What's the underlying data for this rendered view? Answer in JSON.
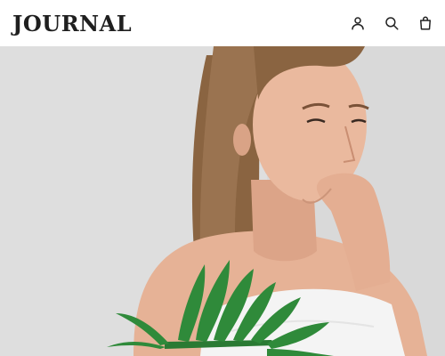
{
  "header": {
    "logo_text": "JOURNAL",
    "icons": [
      "account-icon",
      "search-icon",
      "shopping-bag-icon"
    ]
  },
  "hero": {
    "image_description_icon": "portrait-photo",
    "colors": {
      "background": "#dcdcdc",
      "skin": "#e8b59a",
      "hair": "#8a6441",
      "leaf": "#2f8a3a",
      "towel": "#f4f4f4"
    }
  }
}
